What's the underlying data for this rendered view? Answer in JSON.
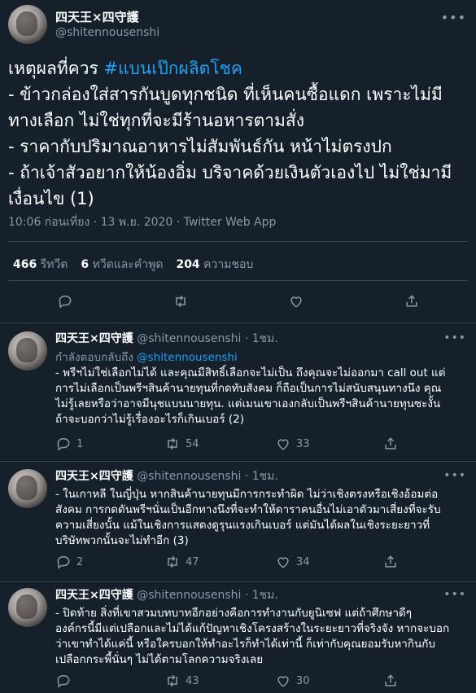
{
  "main": {
    "display_name": "四天王×四守護",
    "username": "@shitennousenshi",
    "text_lead": "เหตุผลที่ควร ",
    "hashtag": "#แบนเป๊กผลิตโชค",
    "text_body": "\n- ข้าวกล่องใส่สารกันบูดทุกชนิด ที่เห็นคนซื้อแดก เพราะไม่มี\nทางเลือก ไม่ใช่ทุกที่จะมีร้านอหารตามสั่ง\n- ราคากับปริมาณอาหารไม่สัมพันธ์กัน หน้าไม่ตรงปก\n- ถ้าเจ้าสัวอยากให้น้องอิ่ม บริจาคด้วยเงินตัวเองไป ไม่ใช่มามี\nเงื่อนไข (1)",
    "meta": "10:06 ก่อนเที่ยง · 13 พ.ย. 2020 · Twitter Web App",
    "retweets_count": "466",
    "retweets_label": "รีทวีต",
    "quotes_count": "6",
    "quotes_label": "ทวีตและคำพูด",
    "likes_count": "204",
    "likes_label": "ความชอบ"
  },
  "replies": [
    {
      "display_name": "四天王×四守護",
      "username": "@shitennousenshi",
      "time": "· 1ชม.",
      "replying_label": "กำลังตอบกลับถึง ",
      "replying_to": "@shitennousenshi",
      "text": "- พรีฯไม่ใช่เลือกไม่ได้ และคุณมีสิทธิ์เลือกจะไม่เป็น ถึงคุณจะไม่ออกมา call out แต่\nการไม่เลือกเป็นพรีฯสินค้านายทุนที่กดทับสังคม ก็ถือเป็นการไม่สนับสนุนทางนึง คุณ\nไม่รู้เลยหรือว่าอาจมีนุชแบนนายทุน. แต่เมนเขาเองกลับเป็นพรีฯสินค้านายทุนซะงั้น\nถ้าจะบอกว่าไม่รู้เรื่องอะไรก็เกินเบอร์ (2)",
      "reply_count": "1",
      "retweet_count": "54",
      "like_count": "33"
    },
    {
      "display_name": "四天王×四守護",
      "username": "@shitennousenshi",
      "time": "· 1ชม.",
      "text": "- ในเกาหลี ในญี่ปุ่น หากสินค้านายทุนมีการกระทำผิด ไม่ว่าเชิงตรงหรือเชิงอ้อมต่อ\nสังคม การกดดันพรีฯนั่นเป็นอีกทางนึงที่จะทำให้ดาราคนอื่นไม่เอาตัวมาเสี่ยงที่จะรับ\nความเสี่ยงนั้น แม้ในเชิงการแสดงดูรุนแรงเกินเบอร์ แต่มันได้ผลในเชิงระยะยาวที่\nบริษัทพวกนั้นจะไม่ทำอีก (3)",
      "reply_count": "2",
      "retweet_count": "47",
      "like_count": "34"
    },
    {
      "display_name": "四天王×四守護",
      "username": "@shitennousenshi",
      "time": "· 1ชม.",
      "text": "- ปิดท้าย สิ่งที่เขาสวมบทบาทอีกอย่างคือการทำงานกับยูนิเซฟ แต่ถ้าศึกษาดีๆ\nองค์กรนี้มีแต่เปลือกและไม่ได้แก้ปัญหาเชิงโครงสร้างในระยะยาวที่จริงจัง หากจะบอก\nว่าเขาทำได้แค่นี้ หรือใครบอกให้ทำอะไรก็ทำได้เท่านี้ ก็เท่ากับคุณยอมรับหากินกับ\nเปลือกกระพี้นั่นๆ ไม่ได้ตามโลกความจริงเลย",
      "reply_count": "",
      "retweet_count": "43",
      "like_count": "30"
    }
  ],
  "icons": [
    "more-icon",
    "reply-icon",
    "retweet-icon",
    "like-icon",
    "share-icon"
  ]
}
